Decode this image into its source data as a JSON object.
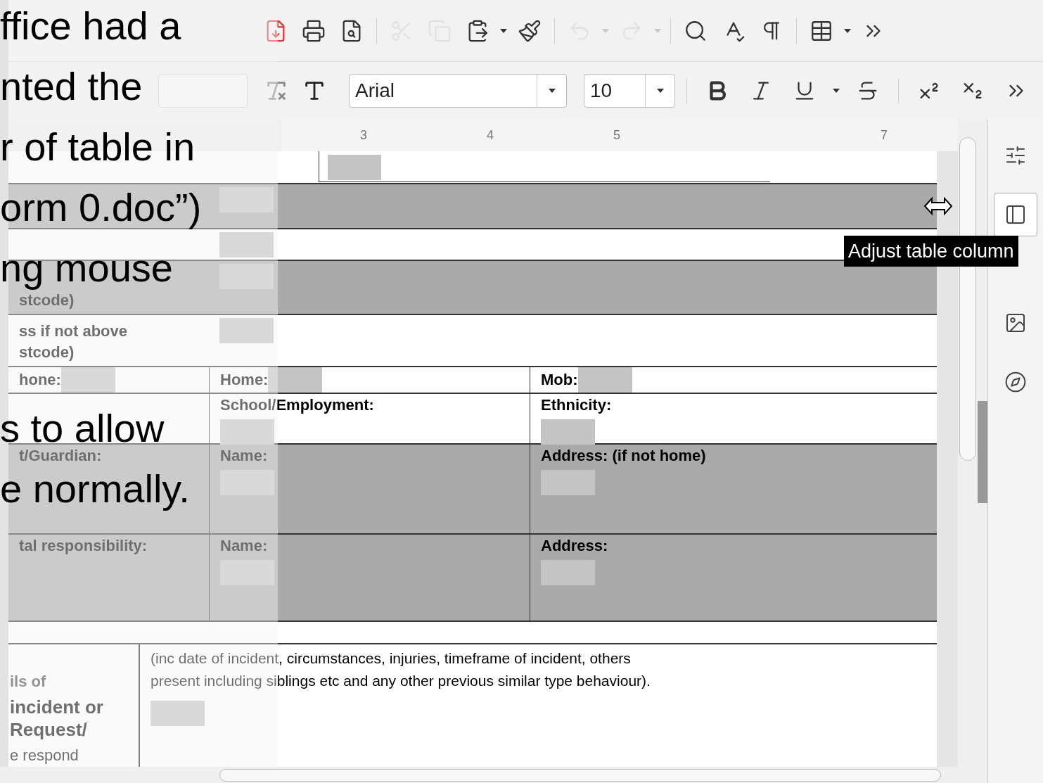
{
  "caption": {
    "paragraphs": [
      [
        "ffice had a",
        "nted the",
        "r of table in",
        "orm 0.doc”)",
        "ng mouse"
      ],
      [
        "s to allow",
        "e normally."
      ]
    ]
  },
  "toolbar": [
    {
      "kind": "pdf",
      "disabled": false
    },
    {
      "kind": "print",
      "disabled": false
    },
    {
      "kind": "preview",
      "disabled": false
    },
    {
      "kind": "sep"
    },
    {
      "kind": "cut",
      "disabled": true
    },
    {
      "kind": "copy",
      "disabled": true
    },
    {
      "kind": "paste",
      "disabled": false
    },
    {
      "kind": "dropdown",
      "disabled": false
    },
    {
      "kind": "brush",
      "disabled": false
    },
    {
      "kind": "sep"
    },
    {
      "kind": "undo",
      "disabled": true
    },
    {
      "kind": "dropdown",
      "disabled": true
    },
    {
      "kind": "redo",
      "disabled": true
    },
    {
      "kind": "dropdown",
      "disabled": true
    },
    {
      "kind": "sep"
    },
    {
      "kind": "find",
      "disabled": false
    },
    {
      "kind": "spelling",
      "disabled": false
    },
    {
      "kind": "pilcrow",
      "disabled": false
    },
    {
      "kind": "sep"
    },
    {
      "kind": "table",
      "disabled": false
    },
    {
      "kind": "dropdown",
      "disabled": false
    },
    {
      "kind": "more",
      "disabled": false
    }
  ],
  "format_bar": {
    "font": {
      "value": "Arial"
    },
    "size": {
      "value": "10"
    },
    "buttons": [
      {
        "kind": "bold"
      },
      {
        "kind": "italic"
      },
      {
        "kind": "underline"
      },
      {
        "kind": "dropdown"
      },
      {
        "kind": "strike"
      },
      {
        "kind": "sep"
      },
      {
        "kind": "superscript"
      },
      {
        "kind": "subscript"
      },
      {
        "kind": "more"
      }
    ]
  },
  "ruler": {
    "numbers": [
      "3",
      "4",
      "5",
      "7"
    ]
  },
  "form": {
    "rows": [
      {
        "kind": "wide",
        "shaded": true,
        "cells": [
          {
            "field": false
          },
          {
            "field": true
          }
        ]
      },
      {
        "kind": "wide",
        "shaded": false,
        "cells": [
          {
            "field": false
          },
          {
            "field": true
          }
        ]
      },
      {
        "kind": "wide",
        "shaded": true,
        "cells": [
          {
            "text": "stcode)",
            "field": false
          },
          {
            "field": true
          }
        ]
      },
      {
        "kind": "wide",
        "shaded": false,
        "cells": [
          {
            "text": "ss if not above\nstcode)",
            "field": false
          },
          {
            "field": true
          }
        ]
      },
      {
        "kind": "inline",
        "shaded": false,
        "cells": [
          {
            "text": "hone:",
            "field": true
          },
          {
            "text": "Home:",
            "field": true
          },
          {
            "text": "Mob:",
            "field": true
          }
        ]
      },
      {
        "kind": "stacked",
        "shaded": false,
        "cells": [
          {
            "field": false
          },
          {
            "text": "School/Employment:",
            "field": true
          },
          {
            "text": "Ethnicity:",
            "field": true
          }
        ]
      },
      {
        "kind": "stacked",
        "shaded": true,
        "cells": [
          {
            "text": "t/Guardian:",
            "field": false
          },
          {
            "text": "Name:",
            "field": true
          },
          {
            "text": "Address: (if not home)",
            "field": true
          }
        ]
      },
      {
        "kind": "stacked",
        "shaded": true,
        "cells": [
          {
            "text": "tal responsibility:",
            "field": false
          },
          {
            "text": "Name:",
            "field": true
          },
          {
            "text": "Address:",
            "field": true
          }
        ]
      }
    ],
    "details": {
      "faded": "ils of",
      "bold": "incident or\nRequest/",
      "tail": "e respond",
      "hint": "(inc date of incident, circumstances, injuries, timeframe of incident, others\n present including siblings etc and any other previous similar type behaviour).",
      "field": true
    }
  },
  "tooltip": "Adjust table column",
  "sidebar": [
    {
      "kind": "properties",
      "selected": false
    },
    {
      "kind": "styles",
      "selected": true
    },
    {
      "kind": "gallery",
      "selected": false
    },
    {
      "kind": "navigator",
      "selected": false
    }
  ]
}
